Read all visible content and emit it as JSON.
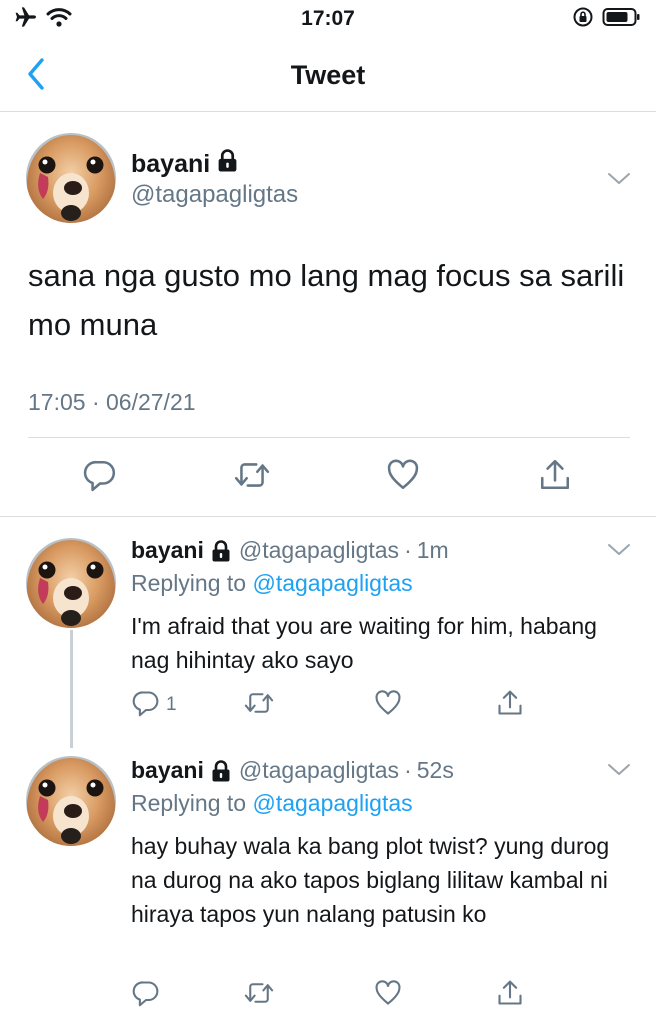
{
  "status_bar": {
    "time": "17:07",
    "icons": [
      "airplane-icon",
      "wifi-icon",
      "orientation-lock-icon",
      "battery-icon"
    ]
  },
  "nav": {
    "title": "Tweet",
    "back_icon": "chevron-left-icon"
  },
  "main_tweet": {
    "display_name": "bayani",
    "handle": "@tagapagligtas",
    "protected": true,
    "text": "sana nga gusto mo lang mag focus sa sarili mo muna",
    "timestamp": "17:05 · 06/27/21",
    "actions": [
      "reply-icon",
      "retweet-icon",
      "like-icon",
      "share-icon"
    ]
  },
  "replies": [
    {
      "display_name": "bayani",
      "handle": "@tagapagligtas",
      "separator": "·",
      "time_ago": "1m",
      "replying_label": "Replying to",
      "replying_to": "@tagapagligtas",
      "text": "I'm afraid that you are waiting for him, habang nag hihintay ako sayo",
      "reply_count": "1"
    },
    {
      "display_name": "bayani",
      "handle": "@tagapagligtas",
      "separator": "·",
      "time_ago": "52s",
      "replying_label": "Replying to",
      "replying_to": "@tagapagligtas",
      "text": "hay buhay wala ka bang plot twist? yung durog na durog na ako tapos biglang lilitaw kambal ni hiraya tapos yun nalang patusin ko",
      "reply_count": ""
    }
  ],
  "colors": {
    "accent": "#1da1f2",
    "secondary_text": "#657786",
    "icon": "#657786",
    "divider": "#dcdcdc"
  }
}
